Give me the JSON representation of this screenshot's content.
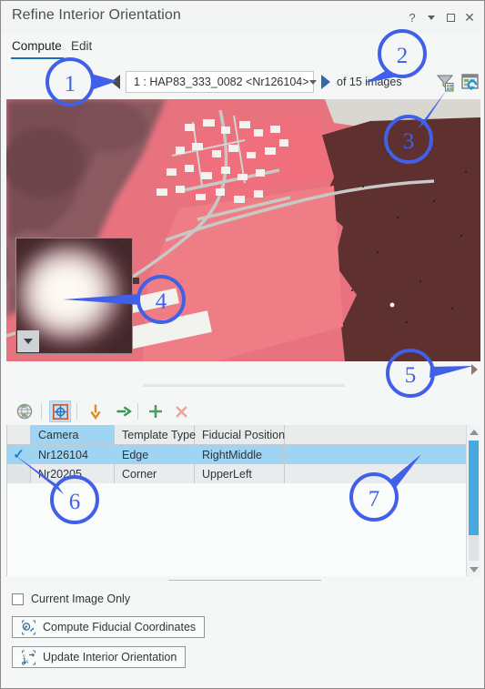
{
  "window": {
    "title": "Refine Interior Orientation",
    "controls": [
      {
        "name": "help-button",
        "glyph": "?"
      },
      {
        "name": "menu-caret-button",
        "glyph": "▾"
      },
      {
        "name": "maximize-button",
        "glyph": "□"
      },
      {
        "name": "close-button",
        "glyph": "✕"
      }
    ]
  },
  "tabs": {
    "items": [
      {
        "label": "Compute",
        "active": true
      },
      {
        "label": "Edit",
        "active": false
      }
    ],
    "accent_color": "#1a73b8"
  },
  "navigation": {
    "prev_label": "◀",
    "next_label": "▶",
    "combo_value": "1 : HAP83_333_0082 <Nr126104>",
    "count_label": "of 15 images",
    "filter_icon": "filter-icon",
    "refresh_icon": "refresh-table-icon"
  },
  "image_pane": {
    "name": "aerial-image-preview",
    "inset_name": "fiducial-zoom-inset",
    "inset_dropdown_label": "▾"
  },
  "splitter": {
    "expand_arrow_label": "▶"
  },
  "table_toolbar": {
    "items": [
      {
        "name": "zoom-to-globe-button",
        "icon": "globe-icon"
      },
      {
        "name": "select-fiducial-button",
        "icon": "crosshair-target-icon",
        "selected": true
      },
      {
        "name": "move-down-button",
        "icon": "down-arrow-icon"
      },
      {
        "name": "move-next-button",
        "icon": "right-arrow-icon"
      },
      {
        "name": "add-row-button",
        "icon": "plus-icon"
      },
      {
        "name": "delete-row-button",
        "icon": "cross-delete-icon"
      }
    ]
  },
  "table": {
    "columns": [
      "",
      "Camera",
      "Template Type",
      "Fiducial Position",
      ""
    ],
    "rows": [
      {
        "checked": "✓",
        "camera": "Nr126104",
        "template_type": "Edge",
        "fiducial_position": "RightMiddle",
        "extra": "",
        "selected": true
      },
      {
        "checked": "",
        "camera": "Nr20205",
        "template_type": "Corner",
        "fiducial_position": "UpperLeft",
        "extra": "",
        "selected": false
      }
    ],
    "selection_color": "#9fd5f2",
    "scrollbar_color": "#4aa8e0"
  },
  "bottom": {
    "checkbox_label": "Current Image Only",
    "checkbox_checked": false,
    "buttons": [
      {
        "label": "Compute Fiducial Coordinates",
        "icon": "compute-fiducial-icon"
      },
      {
        "label": "Update Interior Orientation",
        "icon": "update-orientation-icon"
      }
    ]
  },
  "annotations": {
    "color": "#4060e8",
    "markers": [
      {
        "number": "1",
        "target": "previous-image-arrow"
      },
      {
        "number": "2",
        "target": "of-15-images-count"
      },
      {
        "number": "3",
        "target": "filter-and-refresh-icons"
      },
      {
        "number": "4",
        "target": "fiducial-zoom-inset"
      },
      {
        "number": "5",
        "target": "expand-splitter-arrow"
      },
      {
        "number": "6",
        "target": "row-checkbox-check"
      },
      {
        "number": "7",
        "target": "selected-table-row"
      }
    ]
  }
}
